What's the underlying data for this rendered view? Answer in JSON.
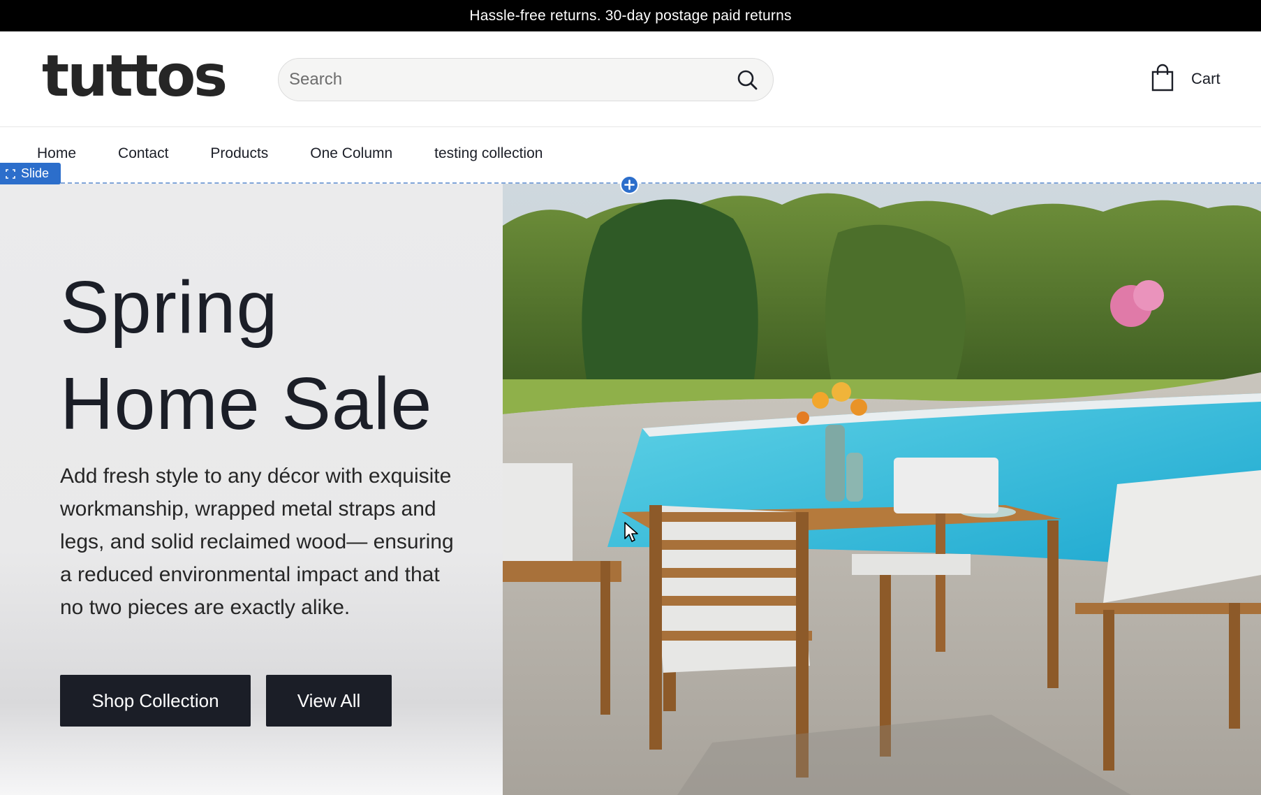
{
  "announcement": {
    "text": "Hassle-free returns. 30-day postage paid returns"
  },
  "header": {
    "logo": "tuttos",
    "search": {
      "placeholder": "Search",
      "value": ""
    },
    "cart_label": "Cart"
  },
  "nav": {
    "items": [
      {
        "label": "Home"
      },
      {
        "label": "Contact"
      },
      {
        "label": "Products"
      },
      {
        "label": "One Column"
      },
      {
        "label": "testing collection"
      }
    ]
  },
  "editor": {
    "section_tag": "Slide"
  },
  "hero": {
    "title_line1": "Spring",
    "title_line2": "Home Sale",
    "text": "Add fresh style to any décor with exquisite workmanship, wrapped metal straps and legs, and solid reclaimed wood— ensuring a reduced environmental impact and that no two pieces are exactly alike.",
    "buttons": {
      "shop": "Shop Collection",
      "view": "View All"
    },
    "image_icon": "patio-dining-set-by-pool-image"
  },
  "colors": {
    "announcement_bg": "#000000",
    "button_bg": "#1b1e27",
    "editor_accent": "#2c6ecb",
    "hero_bg": "#ebebec"
  }
}
